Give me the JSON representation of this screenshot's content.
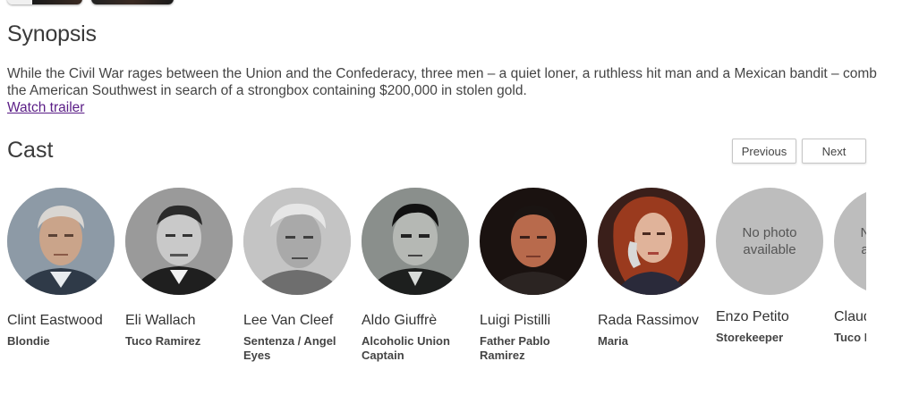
{
  "synopsis": {
    "title": "Synopsis",
    "text": "While the Civil War rages between the Union and the Confederacy, three men – a quiet loner, a ruthless hit man and a Mexican bandit – comb the American Southwest in search of a strongbox containing $200,000 in stolen gold.",
    "trailer_link": "Watch trailer"
  },
  "cast": {
    "title": "Cast",
    "previous_label": "Previous",
    "next_label": "Next",
    "no_photo_text": "No photo available",
    "members": [
      {
        "name": "Clint Eastwood",
        "role": "Blondie",
        "photo": "portrait"
      },
      {
        "name": "Eli Wallach",
        "role": "Tuco Ramirez",
        "photo": "portrait"
      },
      {
        "name": "Lee Van Cleef",
        "role": "Sentenza / Angel Eyes",
        "photo": "portrait"
      },
      {
        "name": "Aldo Giuffrè",
        "role": "Alcoholic Union Captain",
        "photo": "portrait"
      },
      {
        "name": "Luigi Pistilli",
        "role": "Father Pablo Ramirez",
        "photo": "portrait"
      },
      {
        "name": "Rada Rassimov",
        "role": "Maria",
        "photo": "portrait"
      },
      {
        "name": "Enzo Petito",
        "role": "Storekeeper",
        "photo": "none"
      },
      {
        "name": "Claudio Scarchilli",
        "role": "Tuco Bounty Hunter",
        "photo": "none"
      }
    ]
  },
  "colors": {
    "link": "#5a1d86",
    "no_photo_bg": "#bdbdbd"
  }
}
